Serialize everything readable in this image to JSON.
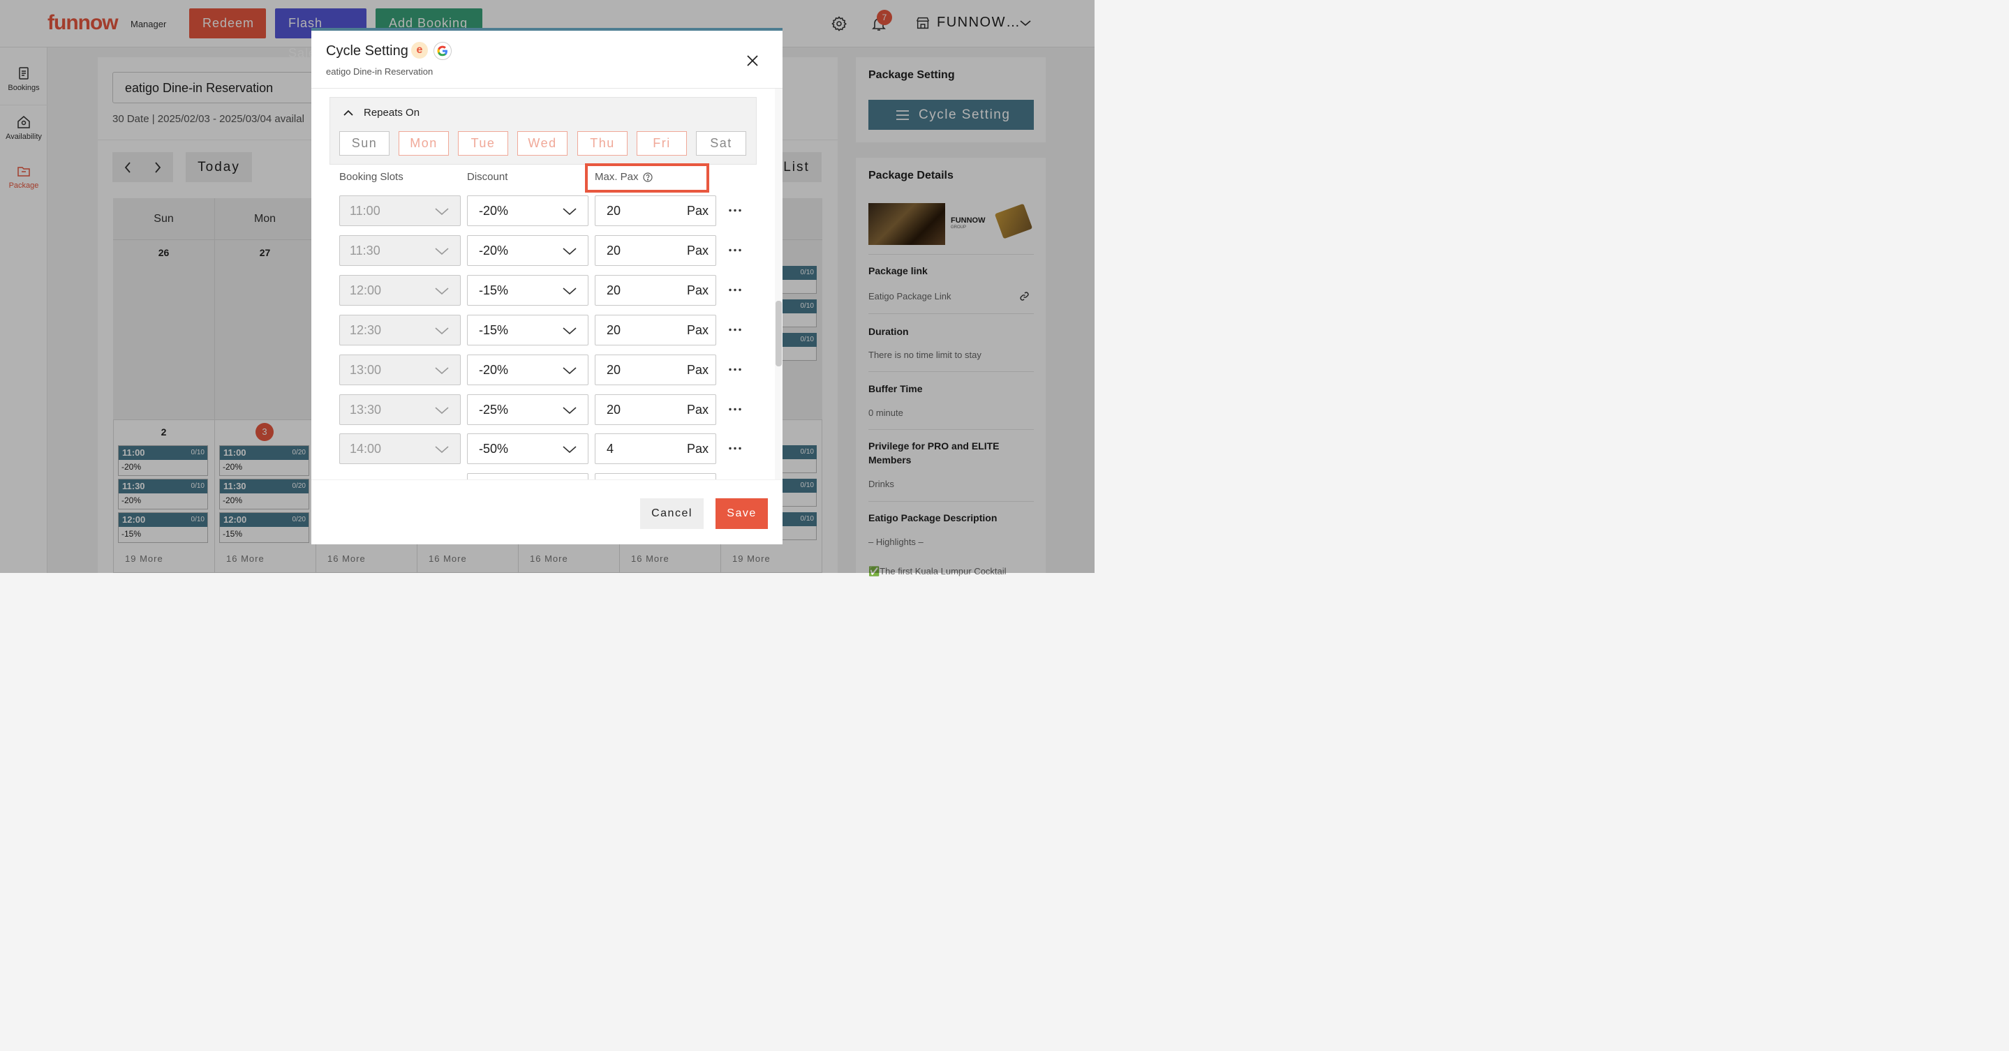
{
  "topbar": {
    "logo": "funnow",
    "logo_sub": "Manager",
    "redeem": "Redeem",
    "flash_sale": "Flash Sale",
    "add_booking": "Add Booking",
    "notification_count": "7",
    "store_name": "FUNNOW…"
  },
  "sidebar": {
    "items": [
      {
        "label": "Bookings"
      },
      {
        "label": "Availability"
      },
      {
        "label": "Package"
      }
    ]
  },
  "main": {
    "package_select": "eatigo Dine-in Reservation",
    "date_info": "30 Date | 2025/02/03 - 2025/03/04 availal",
    "today": "Today",
    "list": "List",
    "days": [
      "Sun",
      "Mon"
    ],
    "week1": [
      "26",
      "27"
    ],
    "week2": [
      "2",
      "3"
    ],
    "sun_slots": [
      {
        "time": "11:00",
        "cap": "0/10",
        "disc": "-20%"
      },
      {
        "time": "11:30",
        "cap": "0/10",
        "disc": "-20%"
      },
      {
        "time": "12:00",
        "cap": "0/10",
        "disc": "-15%"
      }
    ],
    "mon_slots": [
      {
        "time": "11:00",
        "cap": "0/20",
        "disc": "-20%"
      },
      {
        "time": "11:30",
        "cap": "0/20",
        "disc": "-20%"
      },
      {
        "time": "12:00",
        "cap": "0/20",
        "disc": "-15%"
      }
    ],
    "sat_caps": [
      "0/10",
      "0/10",
      "0/10",
      "0/10",
      "0/10",
      "0/10"
    ],
    "more": [
      "19 More",
      "16 More",
      "16 More",
      "16 More",
      "16 More",
      "16 More",
      "19 More"
    ]
  },
  "right_panel": {
    "package_setting": "Package Setting",
    "cycle_setting": "Cycle Setting",
    "package_details": "Package Details",
    "funnow_logo": "FUNNOW",
    "funnow_sub": "GROUP",
    "package_link_label": "Package link",
    "package_link_value": "Eatigo Package Link",
    "duration_label": "Duration",
    "duration_value": "There is no time limit to stay",
    "buffer_label": "Buffer Time",
    "buffer_value": "0 minute",
    "privilege_label_1": "Privilege for PRO and ELITE",
    "privilege_label_2": "Members",
    "privilege_value": "Drinks",
    "desc_label": "Eatigo Package Description",
    "desc_value": "– Highlights –",
    "desc_value_2": "✅The first Kuala Lumpur Cocktail"
  },
  "modal": {
    "title": "Cycle Setting",
    "e_badge": "e",
    "subtitle": "eatigo Dine-in Reservation",
    "repeats_on": "Repeats On",
    "days": [
      {
        "label": "Sun",
        "selected": false
      },
      {
        "label": "Mon",
        "selected": true
      },
      {
        "label": "Tue",
        "selected": true
      },
      {
        "label": "Wed",
        "selected": true
      },
      {
        "label": "Thu",
        "selected": true
      },
      {
        "label": "Fri",
        "selected": true
      },
      {
        "label": "Sat",
        "selected": false
      }
    ],
    "col_slots": "Booking Slots",
    "col_discount": "Discount",
    "col_maxpax": "Max. Pax",
    "pax_unit": "Pax",
    "rows": [
      {
        "time": "11:00",
        "discount": "-20%",
        "pax": "20"
      },
      {
        "time": "11:30",
        "discount": "-20%",
        "pax": "20"
      },
      {
        "time": "12:00",
        "discount": "-15%",
        "pax": "20"
      },
      {
        "time": "12:30",
        "discount": "-15%",
        "pax": "20"
      },
      {
        "time": "13:00",
        "discount": "-20%",
        "pax": "20"
      },
      {
        "time": "13:30",
        "discount": "-25%",
        "pax": "20"
      },
      {
        "time": "14:00",
        "discount": "-50%",
        "pax": "4"
      }
    ],
    "cancel": "Cancel",
    "save": "Save"
  }
}
